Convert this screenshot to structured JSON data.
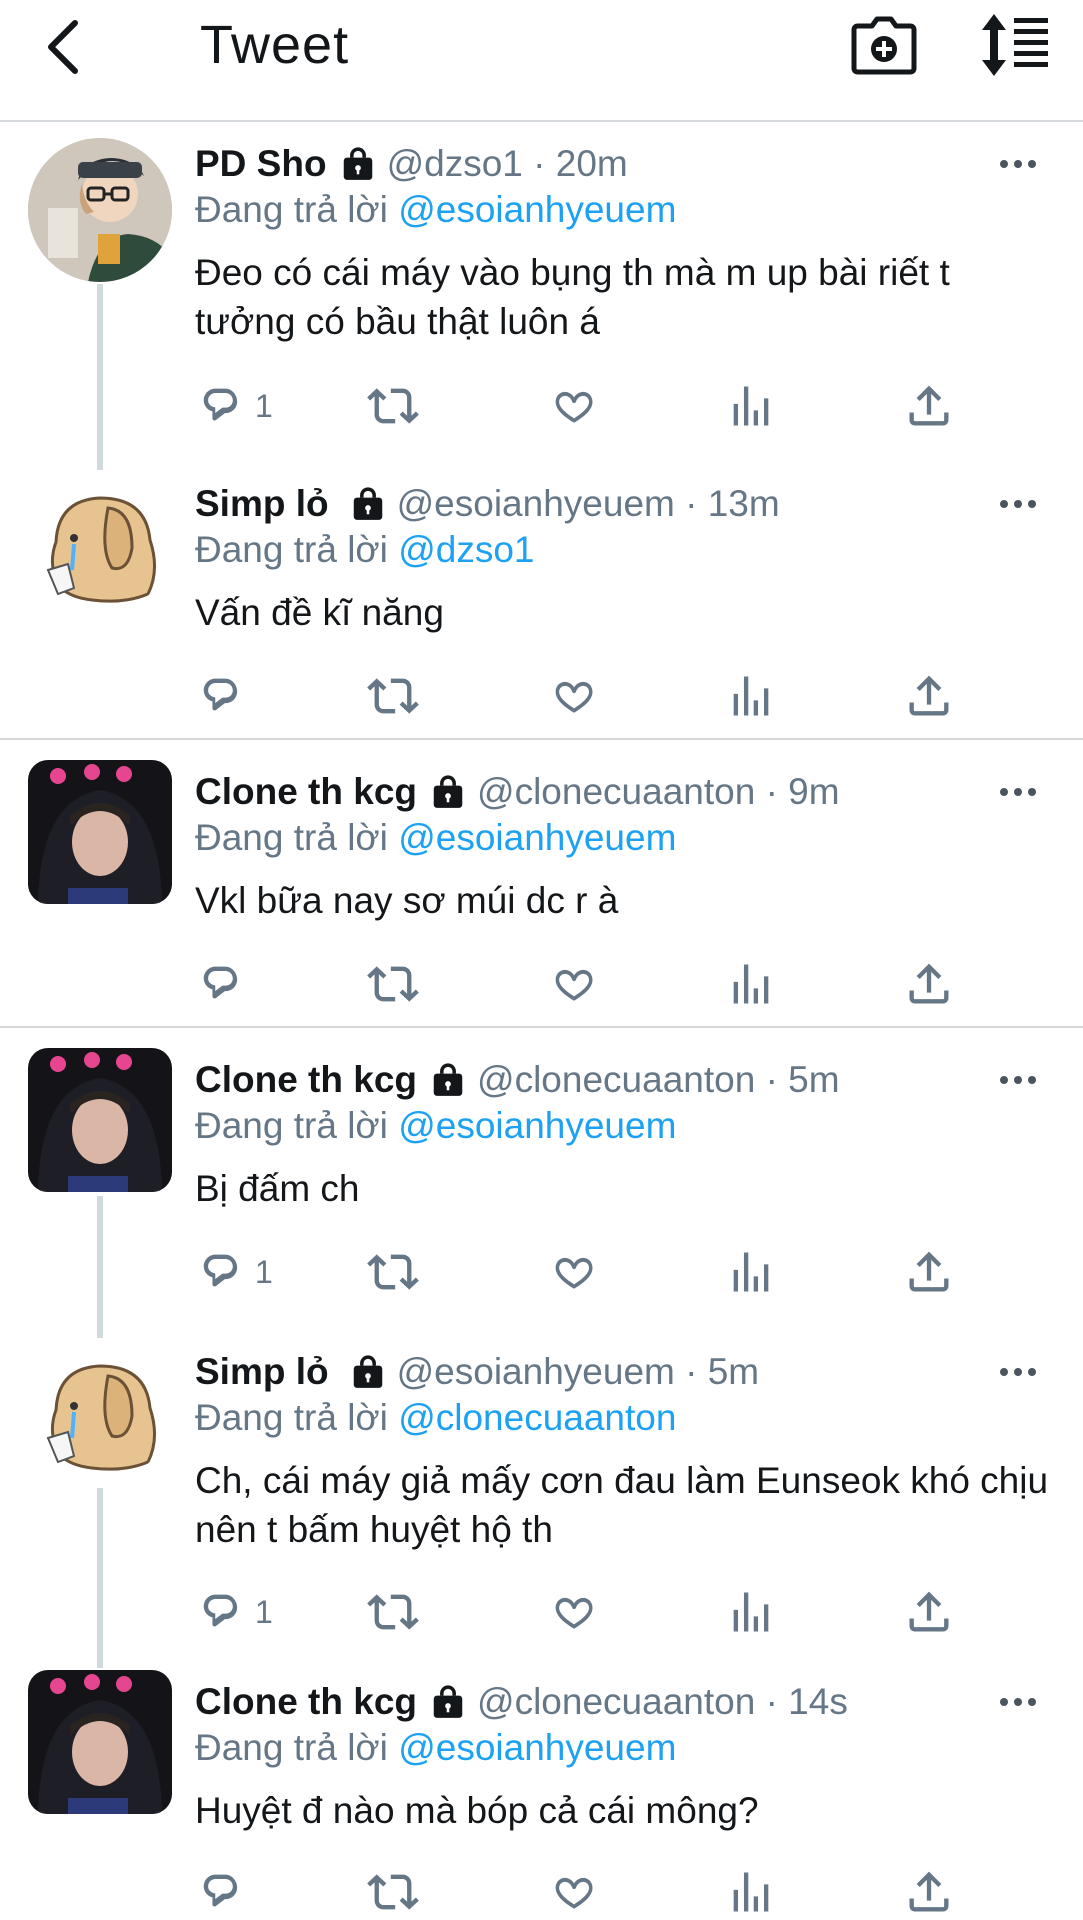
{
  "header": {
    "title": "Tweet",
    "back_icon": "chevron-left-icon",
    "camera_icon": "camera-plus-icon",
    "sort_icon": "sort-arrows-icon"
  },
  "tweets": [
    {
      "display_name": "PD Sho",
      "handle_time": "@dzso1 · 20m",
      "reply_prefix": "Đang trả lời",
      "reply_to": "@esoianhyeuem",
      "text": "Đeo có cái máy vào bụng th mà m up bài riết t tưởng có bầu thật luôn á",
      "reply_count": "1"
    },
    {
      "display_name": "Simp lỏ",
      "handle_time": "@esoianhyeuem · 13m",
      "reply_prefix": "Đang trả lời",
      "reply_to": "@dzso1",
      "text": "Vấn đề kĩ năng",
      "reply_count": ""
    },
    {
      "display_name": "Clone th kcg",
      "handle_time": "@clonecuaanton · 9m",
      "reply_prefix": "Đang trả lời",
      "reply_to": "@esoianhyeuem",
      "text": "Vkl bữa nay sơ múi dc r à",
      "reply_count": ""
    },
    {
      "display_name": "Clone th kcg",
      "handle_time": "@clonecuaanton · 5m",
      "reply_prefix": "Đang trả lời",
      "reply_to": "@esoianhyeuem",
      "text": "Bị đấm ch",
      "reply_count": "1"
    },
    {
      "display_name": "Simp lỏ",
      "handle_time": "@esoianhyeuem · 5m",
      "reply_prefix": "Đang trả lời",
      "reply_to": "@clonecuaanton",
      "text": "Ch, cái máy giả mấy cơn đau làm Eunseok khó chịu nên t bấm huyệt hộ th",
      "reply_count": "1"
    },
    {
      "display_name": "Clone th kcg",
      "handle_time": "@clonecuaanton · 14s",
      "reply_prefix": "Đang trả lời",
      "reply_to": "@esoianhyeuem",
      "text": "Huyệt đ nào mà bóp cả cái mông?",
      "reply_count": ""
    }
  ],
  "colors": {
    "link": "#1da1f2",
    "secondary_text": "#657786",
    "divider": "#d5d9dd",
    "thread_line": "#cfd9de"
  }
}
